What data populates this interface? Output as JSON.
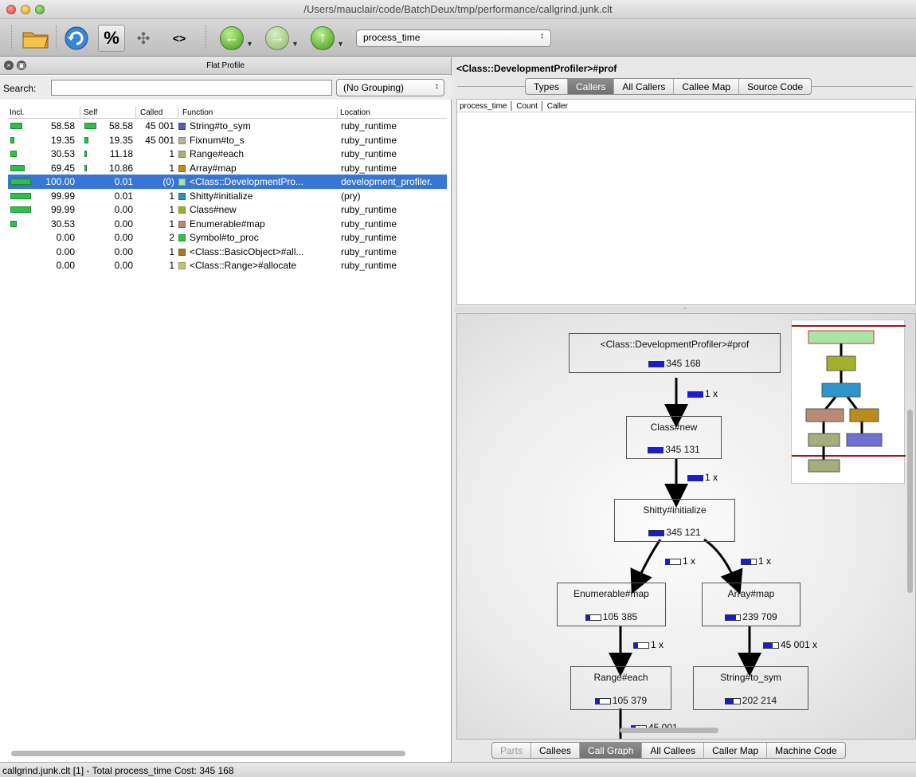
{
  "window": {
    "title": "/Users/mauclair/code/BatchDeux/tmp/performance/callgrind.junk.clt"
  },
  "toolbar": {
    "icons": [
      "folder-icon",
      "reload-icon",
      "percent-icon",
      "move-icon",
      "cycle-icon",
      "back-icon",
      "forward-icon",
      "up-icon"
    ],
    "percent_label": "%",
    "cycle_label": "<>",
    "move_label": "✣",
    "event_select": "process_time"
  },
  "left_panel": {
    "title": "Flat Profile",
    "search_label": "Search:",
    "search_value": "",
    "grouping": "(No Grouping)",
    "columns": [
      "Incl.",
      "Self",
      "Called",
      "Function",
      "Location"
    ],
    "rows": [
      {
        "incl": "58.58",
        "incl_bar": 0.5858,
        "self": "58.58",
        "self_bar": 0.5858,
        "called": "45 001",
        "color": "#5a5ab5",
        "function": "String#to_sym",
        "location": "ruby_runtime",
        "selected": false
      },
      {
        "incl": "19.35",
        "incl_bar": 0.1935,
        "self": "19.35",
        "self_bar": 0.1935,
        "called": "45 001",
        "color": "#b8b49a",
        "function": "Fixnum#to_s",
        "location": "ruby_runtime",
        "selected": false
      },
      {
        "incl": "30.53",
        "incl_bar": 0.3053,
        "self": "11.18",
        "self_bar": 0.1118,
        "called": "1",
        "color": "#a8b07a",
        "function": "Range#each",
        "location": "ruby_runtime",
        "selected": false
      },
      {
        "incl": "69.45",
        "incl_bar": 0.6945,
        "self": "10.86",
        "self_bar": 0.1086,
        "called": "1",
        "color": "#b88f1f",
        "function": "Array#map",
        "location": "ruby_runtime",
        "selected": false
      },
      {
        "incl": "100.00",
        "incl_bar": 1.0,
        "self": "0.01",
        "self_bar": 0.0,
        "called": "(0)",
        "color": "#a5e4a8",
        "function": "<Class::DevelopmentPro...",
        "location": "development_profiler.",
        "selected": true
      },
      {
        "incl": "99.99",
        "incl_bar": 0.9999,
        "self": "0.01",
        "self_bar": 0.0,
        "called": "1",
        "color": "#2a8fc4",
        "function": "Shitty#initialize",
        "location": "(pry)",
        "selected": false
      },
      {
        "incl": "99.99",
        "incl_bar": 0.9999,
        "self": "0.00",
        "self_bar": 0.0,
        "called": "1",
        "color": "#9fb036",
        "function": "Class#new",
        "location": "ruby_runtime",
        "selected": false
      },
      {
        "incl": "30.53",
        "incl_bar": 0.3053,
        "self": "0.00",
        "self_bar": 0.0,
        "called": "1",
        "color": "#b88a7a",
        "function": "Enumerable#map",
        "location": "ruby_runtime",
        "selected": false
      },
      {
        "incl": "0.00",
        "incl_bar": 0.0,
        "self": "0.00",
        "self_bar": 0.0,
        "called": "2",
        "color": "#2fbf4a",
        "function": "Symbol#to_proc",
        "location": "ruby_runtime",
        "selected": false
      },
      {
        "incl": "0.00",
        "incl_bar": 0.0,
        "self": "0.00",
        "self_bar": 0.0,
        "called": "1",
        "color": "#a8781f",
        "function": "<Class::BasicObject>#all...",
        "location": "ruby_runtime",
        "selected": false
      },
      {
        "incl": "0.00",
        "incl_bar": 0.0,
        "self": "0.00",
        "self_bar": 0.0,
        "called": "1",
        "color": "#c4c478",
        "function": "<Class::Range>#allocate",
        "location": "ruby_runtime",
        "selected": false
      }
    ]
  },
  "right_top": {
    "title": "<Class::DevelopmentProfiler>#prof",
    "tabs": [
      {
        "label": "Types",
        "active": false
      },
      {
        "label": "Callers",
        "active": true
      },
      {
        "label": "All Callers",
        "active": false
      },
      {
        "label": "Callee Map",
        "active": false
      },
      {
        "label": "Source Code",
        "active": false
      }
    ],
    "table_header": "process_time │ Count │ Caller"
  },
  "graph": {
    "nodes": [
      {
        "id": "prof",
        "label": "<Class::DevelopmentProfiler>#prof",
        "value": "345 168",
        "fill": 1.0,
        "color": "#a8e6a8",
        "border": "#d03030"
      },
      {
        "id": "classnew",
        "label": "Class#new",
        "value": "345 131",
        "fill": 1.0,
        "color": "#a5b02a",
        "border": "#555"
      },
      {
        "id": "shitty",
        "label": "Shitty#initialize",
        "value": "345 121",
        "fill": 1.0,
        "color": "#2b95cc",
        "border": "#555"
      },
      {
        "id": "enummap",
        "label": "Enumerable#map",
        "value": "105 385",
        "fill": 0.3,
        "color": "#b98a78",
        "border": "#555"
      },
      {
        "id": "arraymap",
        "label": "Array#map",
        "value": "239 709",
        "fill": 0.69,
        "color": "#b98d1c",
        "border": "#555"
      },
      {
        "id": "rangeeach",
        "label": "Range#each",
        "value": "105 379",
        "fill": 0.3,
        "color": "#a7ad7a",
        "border": "#555"
      },
      {
        "id": "tosym",
        "label": "String#to_sym",
        "value": "202 214",
        "fill": 0.59,
        "color": "#7070d0",
        "border": "#555"
      }
    ],
    "edges": [
      {
        "label": "1 x",
        "fill": 1.0
      },
      {
        "label": "1 x",
        "fill": 1.0
      },
      {
        "label": "1 x",
        "fill": 0.3
      },
      {
        "label": "1 x",
        "fill": 0.69
      },
      {
        "label": "1 x",
        "fill": 0.3
      },
      {
        "label": "45 001 x",
        "fill": 0.59
      },
      {
        "label": "45 001",
        "fill": 0.3
      }
    ]
  },
  "bottom_tabs": [
    {
      "label": "Parts",
      "active": false,
      "disabled": true
    },
    {
      "label": "Callees",
      "active": false,
      "disabled": false
    },
    {
      "label": "Call Graph",
      "active": true,
      "disabled": false
    },
    {
      "label": "All Callees",
      "active": false,
      "disabled": false
    },
    {
      "label": "Caller Map",
      "active": false,
      "disabled": false
    },
    {
      "label": "Machine Code",
      "active": false,
      "disabled": false
    }
  ],
  "status": "callgrind.junk.clt [1] - Total process_time Cost: 345 168"
}
